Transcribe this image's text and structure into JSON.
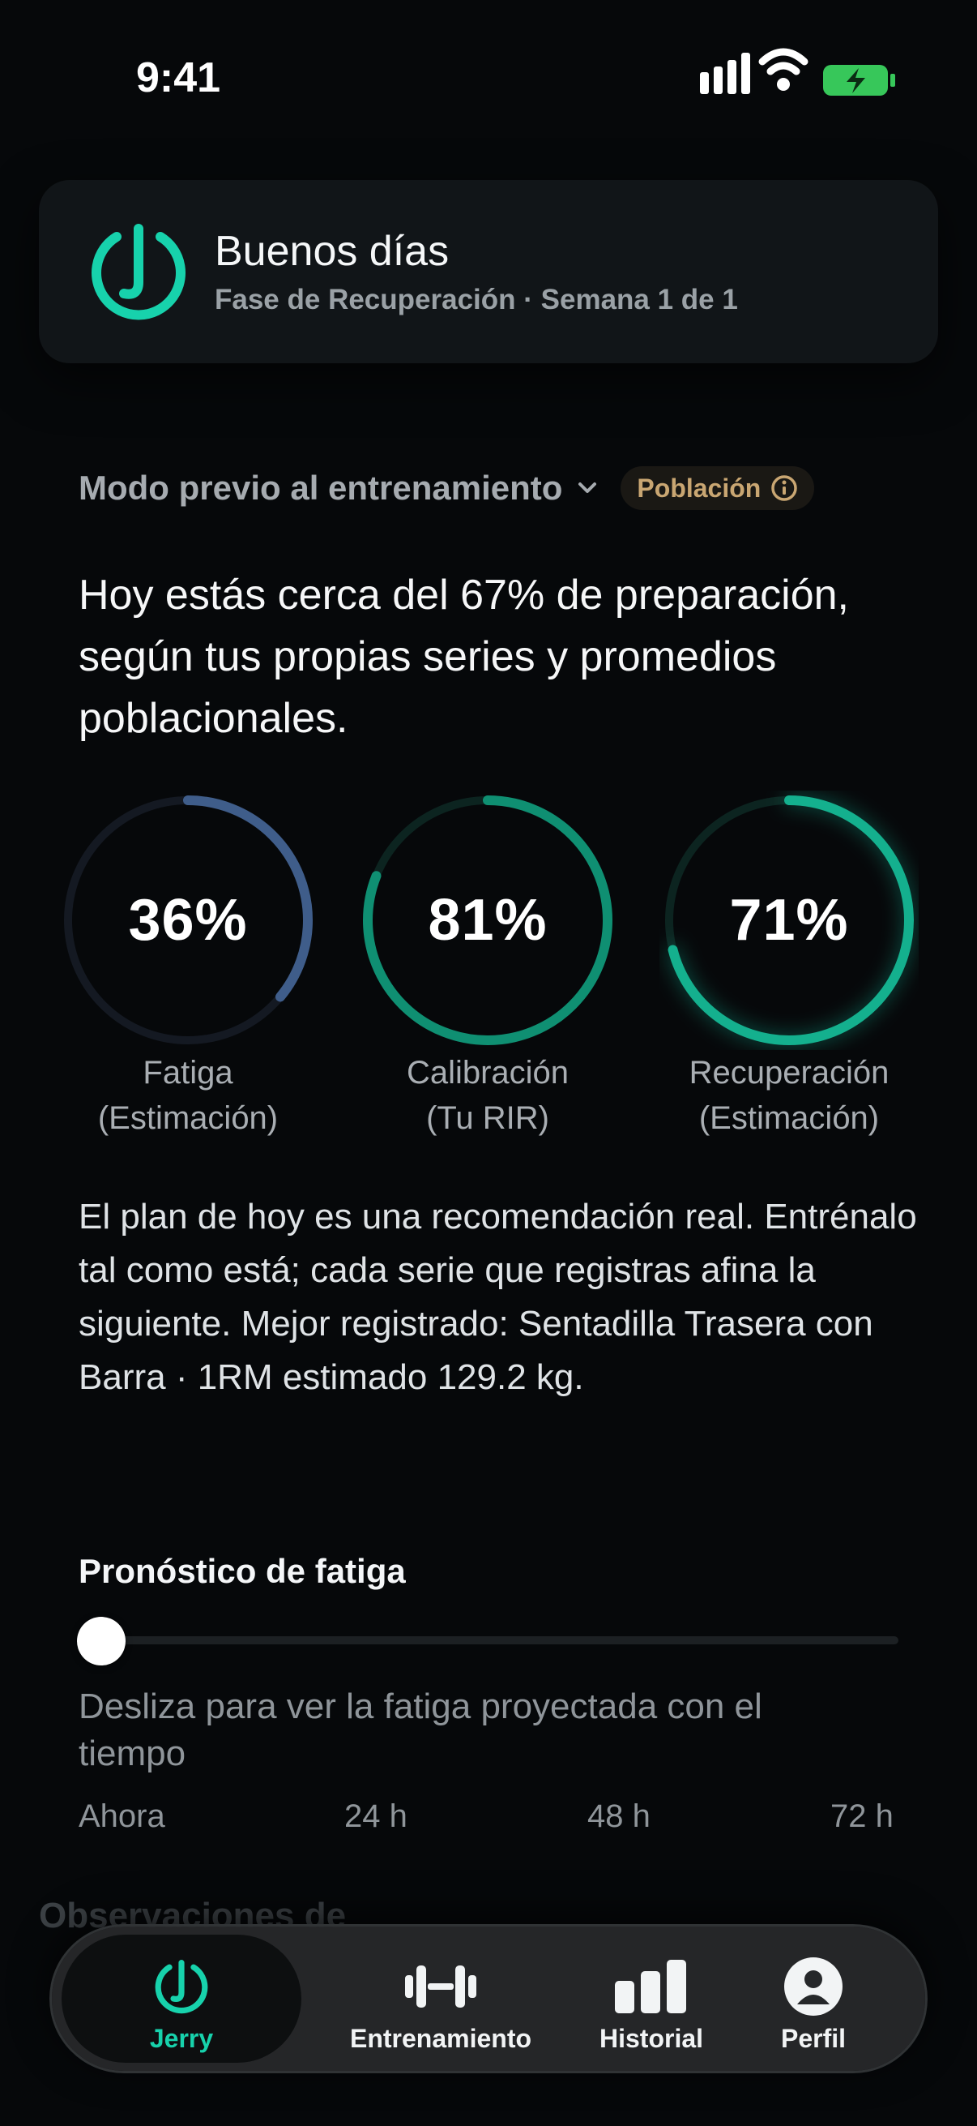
{
  "status_bar": {
    "time": "9:41"
  },
  "header": {
    "greeting": "Buenos días",
    "phase": "Fase de Recuperación · Semana 1 de 1"
  },
  "mode": {
    "label": "Modo previo al entrenamiento",
    "badge": "Población"
  },
  "headline": "Hoy estás cerca del 67% de preparación, según tus propias series y promedios poblacionales.",
  "gauges": [
    {
      "value_text": "36%",
      "value": 36,
      "label_line1": "Fatiga",
      "label_line2": "(Estimación)",
      "color": "#3f5d8a"
    },
    {
      "value_text": "81%",
      "value": 81,
      "label_line1": "Calibración",
      "label_line2": "(Tu RIR)",
      "color": "#0f8f72"
    },
    {
      "value_text": "71%",
      "value": 71,
      "label_line1": "Recuperación",
      "label_line2": "(Estimación)",
      "color": "#14b08e"
    }
  ],
  "plan_text": "El plan de hoy es una recomendación real. Entrénalo tal como está; cada serie que registras afina la siguiente. Mejor registrado: Sentadilla Trasera con Barra · 1RM estimado 129.2 kg.",
  "forecast": {
    "title": "Pronóstico de fatiga",
    "description": "Desliza para ver la fatiga proyectada con el tiempo",
    "ticks": [
      "Ahora",
      "24 h",
      "48 h",
      "72 h"
    ],
    "slider_value": 0
  },
  "next_section_peek": "Observaciones de",
  "tabs": [
    {
      "label": "Jerry",
      "icon": "jerry-logo-icon",
      "active": true
    },
    {
      "label": "Entrenamiento",
      "icon": "dumbbell-icon",
      "active": false
    },
    {
      "label": "Historial",
      "icon": "bar-chart-icon",
      "active": false
    },
    {
      "label": "Perfil",
      "icon": "profile-icon",
      "active": false
    }
  ],
  "colors": {
    "accent": "#17d2ac",
    "badge": "#c9a672",
    "background": "#06080a"
  }
}
